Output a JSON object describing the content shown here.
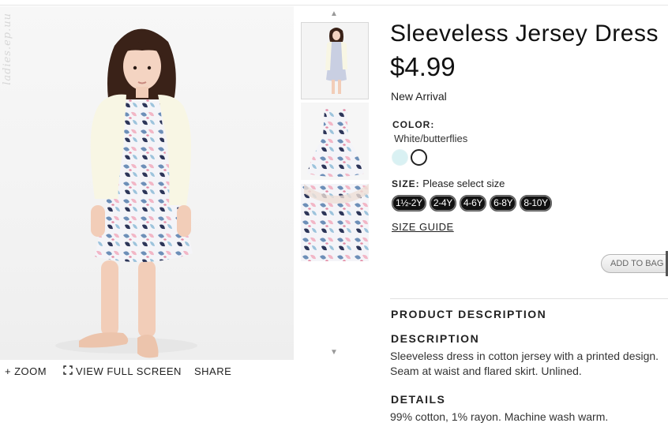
{
  "watermark": "ladies.ep.uu",
  "product": {
    "title": "Sleeveless Jersey Dress",
    "price": "$4.99",
    "badge": "New Arrival",
    "color_label": "COLOR:",
    "color_value": "White/butterflies",
    "swatches": [
      {
        "name": "light turquoise",
        "color": "#d9f1f3"
      },
      {
        "name": "white",
        "color": "#ffffff"
      }
    ],
    "size_label": "SIZE:",
    "size_prompt": "Please select size",
    "sizes": [
      "1½-2Y",
      "2-4Y",
      "4-6Y",
      "6-8Y",
      "8-10Y"
    ],
    "size_guide": "SIZE GUIDE",
    "add_to_bag": "ADD TO BAG"
  },
  "image_toolbar": {
    "zoom": "ZOOM",
    "full_screen": "VIEW FULL SCREEN",
    "share": "SHARE"
  },
  "icons": {
    "zoom": "plus-icon",
    "full_screen": "expand-icon",
    "thumb_up": "chevron-up-icon",
    "thumb_down": "chevron-down-icon"
  },
  "description": {
    "section_heading": "PRODUCT DESCRIPTION",
    "heading": "DESCRIPTION",
    "line1": "Sleeveless dress in cotton jersey with a printed design.",
    "line2": "Seam at waist and flared skirt. Unlined.",
    "details_heading": "DETAILS",
    "details_text": "99% cotton, 1% rayon. Machine wash warm."
  }
}
